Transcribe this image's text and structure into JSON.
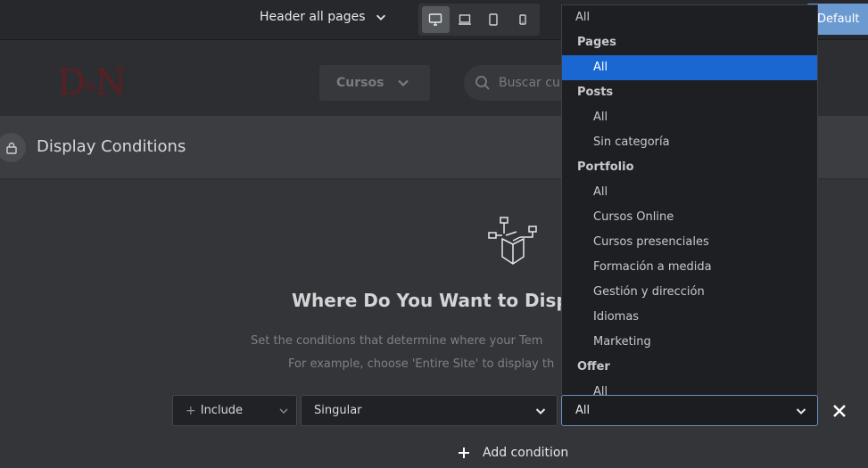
{
  "topbar": {
    "page_label": "Header all pages",
    "devices": [
      "desktop-icon",
      "laptop-icon",
      "tablet-icon",
      "mobile-icon"
    ],
    "default_label": "Default"
  },
  "preview": {
    "logo_text_1": "D",
    "logo_amp": "&",
    "logo_text_2": "N",
    "nav_label": "Cursos",
    "search_placeholder": "Buscar cu"
  },
  "modal": {
    "title": "Display Conditions",
    "heading": "Where Do You Want to Displa",
    "desc_line1": "Set the conditions that determine where your Tem",
    "desc_line2": "For example, choose 'Entire Site' to display th"
  },
  "condition": {
    "include_label": "Include",
    "type_value": "Singular",
    "target_value": "All",
    "add_label": "Add condition"
  },
  "dropdown": {
    "items": [
      {
        "label": "All",
        "kind": "lvl0"
      },
      {
        "label": "Pages",
        "kind": "group"
      },
      {
        "label": "All",
        "kind": "lvl1",
        "selected": true
      },
      {
        "label": "Posts",
        "kind": "group"
      },
      {
        "label": "All",
        "kind": "lvl1"
      },
      {
        "label": "Sin categoría",
        "kind": "lvl1"
      },
      {
        "label": "Portfolio",
        "kind": "group"
      },
      {
        "label": "All",
        "kind": "lvl1"
      },
      {
        "label": "Cursos Online",
        "kind": "lvl1"
      },
      {
        "label": "Cursos presenciales",
        "kind": "lvl1"
      },
      {
        "label": "Formación a medida",
        "kind": "lvl1"
      },
      {
        "label": "Gestión y dirección",
        "kind": "lvl1"
      },
      {
        "label": "Idiomas",
        "kind": "lvl1"
      },
      {
        "label": "Marketing",
        "kind": "lvl1"
      },
      {
        "label": "Offer",
        "kind": "group"
      },
      {
        "label": "All",
        "kind": "lvl1"
      }
    ]
  },
  "colors": {
    "selected": "#1a67d2",
    "accent_button": "#6b9ad0",
    "logo": "#5a1f24"
  }
}
